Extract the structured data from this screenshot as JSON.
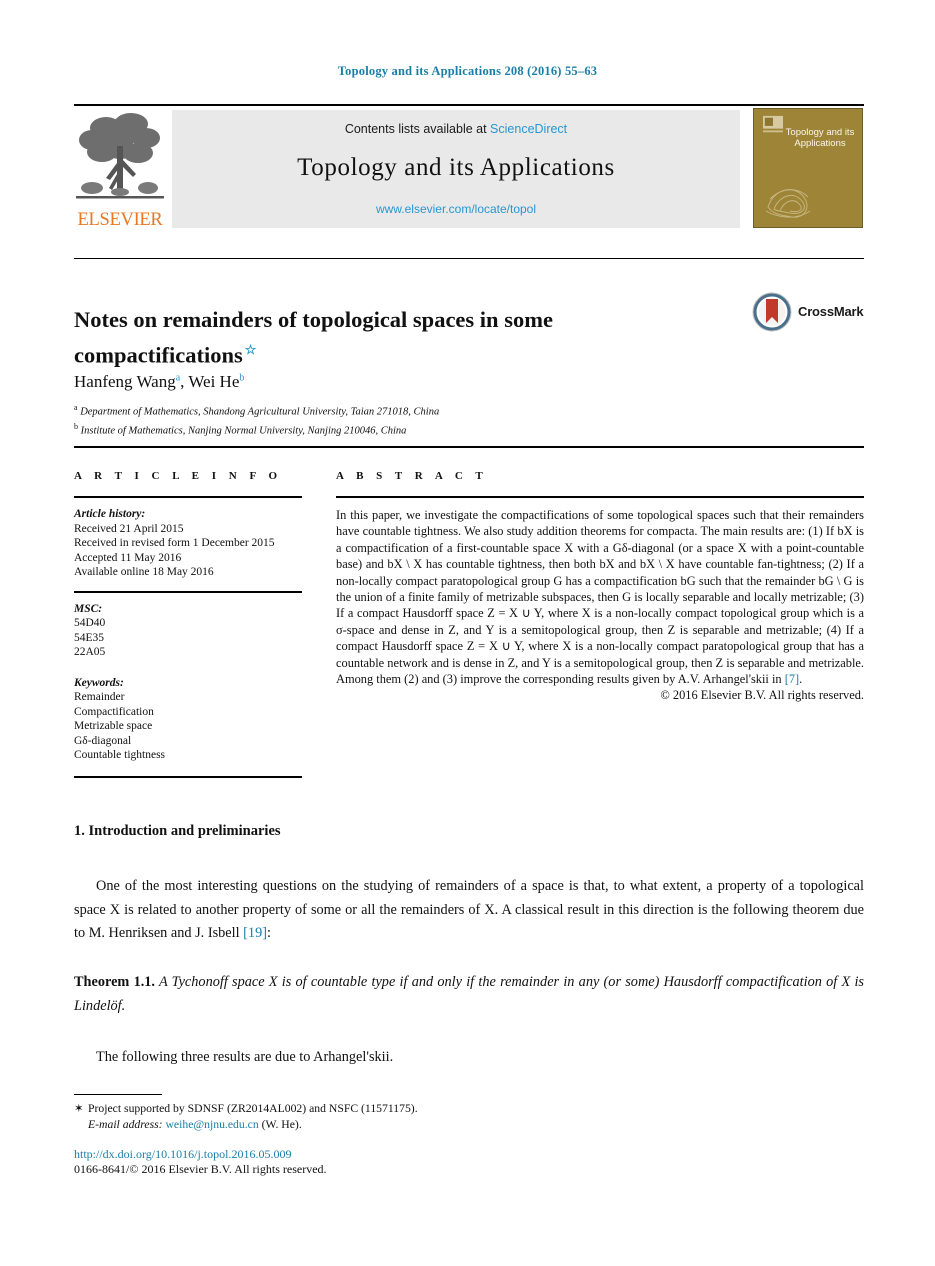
{
  "running_head": "Topology and its Applications 208 (2016) 55–63",
  "masthead": {
    "contents_prefix": "Contents lists available at ",
    "sciencedirect": "ScienceDirect",
    "journal_title": "Topology and its Applications",
    "journal_url": "www.elsevier.com/locate/topol",
    "publisher_wordmark": "ELSEVIER",
    "cover_title": "Topology and its Applications"
  },
  "title": {
    "text": "Notes on remainders of topological spaces in some compactifications",
    "footnote_marker": "☆"
  },
  "crossmark": {
    "label": "CrossMark"
  },
  "authors": {
    "author1": "Hanfeng Wang",
    "author1_mark": "a",
    "separator": ", ",
    "author2": "Wei He",
    "author2_mark": "b"
  },
  "affiliations": [
    {
      "mark": "a",
      "text": "Department of Mathematics, Shandong Agricultural University, Taian 271018, China"
    },
    {
      "mark": "b",
      "text": "Institute of Mathematics, Nanjing Normal University, Nanjing 210046, China"
    }
  ],
  "article_info": {
    "heading": "A R T I C L E   I N F O",
    "history_title": "Article history:",
    "history_lines": "Received 21 April 2015\nReceived in revised form 1 December 2015\nAccepted 11 May 2016\nAvailable online 18 May 2016",
    "msc_title": "MSC:",
    "msc_codes": "54D40\n54E35\n22A05",
    "keywords_title": "Keywords:",
    "keywords": "Remainder\nCompactification\nMetrizable space\nGδ-diagonal\nCountable tightness"
  },
  "abstract": {
    "heading": "A B S T R A C T",
    "body": "In this paper, we investigate the compactifications of some topological spaces such that their remainders have countable tightness. We also study addition theorems for compacta. The main results are: (1) If bX is a compactification of a first-countable space X with a Gδ-diagonal (or a space X with a point-countable base) and bX \\ X has countable tightness, then both bX and bX \\ X have countable fan-tightness; (2) If a non-locally compact paratopological group G has a compactification bG such that the remainder bG \\ G is the union of a finite family of metrizable subspaces, then G is locally separable and locally metrizable; (3) If a compact Hausdorff space Z = X ∪ Y, where X is a non-locally compact topological group which is a σ-space and dense in Z, and Y is a semitopological group, then Z is separable and metrizable; (4) If a compact Hausdorff space Z = X ∪ Y, where X is a non-locally compact paratopological group that has a countable network and is dense in Z, and Y is a semitopological group, then Z is separable and metrizable. Among them (2) and (3) improve the corresponding results given by A.V. Arhangel'skii in ",
    "reference_link": "[7]",
    "body_tail": ".",
    "copyright": "© 2016 Elsevier B.V. All rights reserved."
  },
  "section": {
    "heading": "1. Introduction and preliminaries",
    "paragraph1_a": "One of the most interesting questions on the studying of remainders of a space is that, to what extent, a property of a topological space X is related to another property of some or all the remainders of X. A classical result in this direction is the following theorem due to M. Henriksen and J. Isbell ",
    "paragraph1_ref": "[19]",
    "paragraph1_b": ":",
    "theorem_label": "Theorem",
    "theorem_number": "1.1.",
    "theorem_text": "A Tychonoff space X is of countable type if and only if the remainder in any (or some) Hausdorff compactification of X is Lindelöf.",
    "paragraph2": "The following three results are due to Arhangel'skii."
  },
  "footnotes": {
    "star": "✶",
    "funding": "Project supported by SDNSF (ZR2014AL002) and NSFC (11571175).",
    "email_label": "E-mail address:",
    "email": "weihe@njnu.edu.cn",
    "email_owner": "(W. He)."
  },
  "footer": {
    "doi": "http://dx.doi.org/10.1016/j.topol.2016.05.009",
    "issn_copyright": "0166-8641/© 2016 Elsevier B.V. All rights reserved."
  },
  "colors": {
    "link_blue": "#1a7fa8",
    "sd_blue": "#2a96cf",
    "elsevier_orange": "#e87722",
    "band_gray": "#e9e9e9",
    "cover_gold": "#9d8436"
  }
}
